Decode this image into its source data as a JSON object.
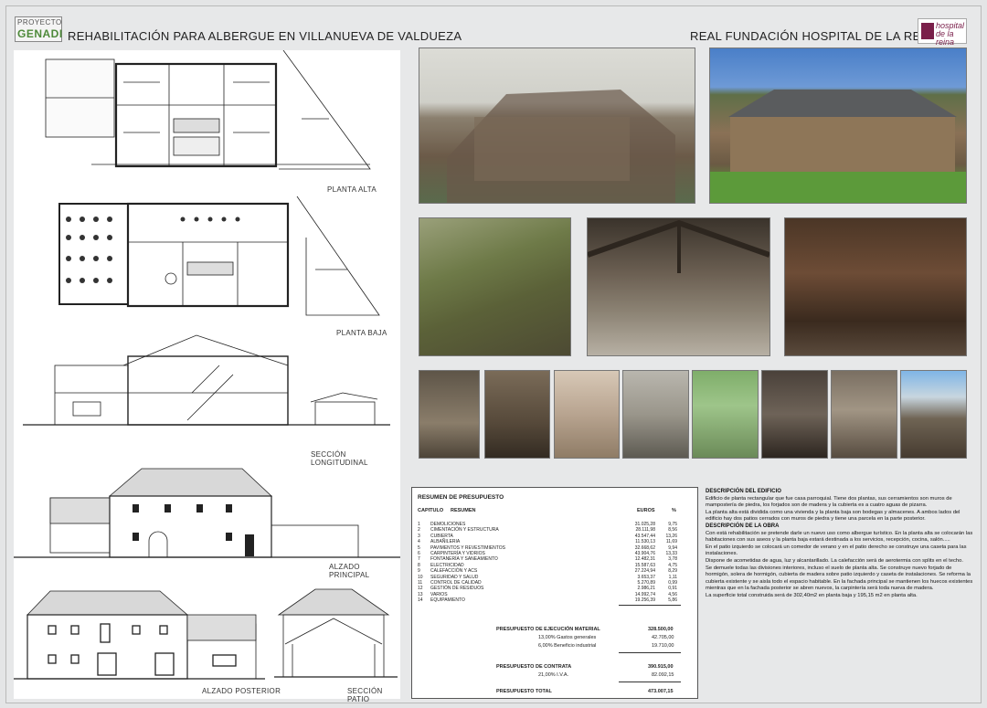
{
  "header": {
    "logo_top": "PROYECTO",
    "logo_bottom": "GENADI",
    "title": "REHABILITACIÓN PARA ALBERGUE EN VILLANUEVA DE VALDUEZA",
    "org": "REAL FUNDACIÓN HOSPITAL DE LA REINA",
    "org_logo_top": "hospital",
    "org_logo_bottom": "de la reina"
  },
  "drawings": {
    "planta_alta": "PLANTA ALTA",
    "planta_baja": "PLANTA BAJA",
    "seccion_longitudinal": "SECCIÓN LONGITUDINAL",
    "alzado_principal": "ALZADO PRINCIPAL",
    "alzado_posterior": "ALZADO POSTERIOR",
    "seccion_patio": "SECCIÓN PATIO"
  },
  "budget": {
    "title": "RESUMEN DE PRESUPUESTO",
    "headers": {
      "capitulo": "CAPITULO",
      "resumen": "RESUMEN",
      "euros": "EUROS",
      "pct": "%"
    },
    "rows": [
      {
        "n": "1",
        "name": "DEMOLICIONES",
        "euros": "31.025,28",
        "pct": "9,75"
      },
      {
        "n": "2",
        "name": "CIMENTACIÓN Y ESTRUCTURA",
        "euros": "28.111,98",
        "pct": "8,56"
      },
      {
        "n": "3",
        "name": "CUBIERTA",
        "euros": "43.547,44",
        "pct": "13,26"
      },
      {
        "n": "4",
        "name": "ALBAÑILERIA",
        "euros": "11.530,13",
        "pct": "11,69"
      },
      {
        "n": "5",
        "name": "PAVIMENTOS Y REVESTIMIENTOS",
        "euros": "32.668,62",
        "pct": "9,94"
      },
      {
        "n": "6",
        "name": "CARPINTERÍA Y VIDRIOS",
        "euros": "43.904,76",
        "pct": "13,33"
      },
      {
        "n": "7",
        "name": "FONTANERÍA Y SANEAMIENTO",
        "euros": "12.482,31",
        "pct": "3,78"
      },
      {
        "n": "8",
        "name": "ELECTRICIDAD",
        "euros": "15.587,63",
        "pct": "4,75"
      },
      {
        "n": "9",
        "name": "CALEFACCIÓN Y ACS",
        "euros": "27.224,94",
        "pct": "8,29"
      },
      {
        "n": "10",
        "name": "SEGURIDAD Y SALUD",
        "euros": "3.653,37",
        "pct": "1,11"
      },
      {
        "n": "11",
        "name": "CONTROL DE CALIDAD",
        "euros": "5.270,89",
        "pct": "0,99"
      },
      {
        "n": "12",
        "name": "GESTIÓN DE RESIDUOS",
        "euros": "2.986,21",
        "pct": "0,91"
      },
      {
        "n": "13",
        "name": "VARIOS",
        "euros": "14.992,74",
        "pct": "4,56"
      },
      {
        "n": "14",
        "name": "EQUIPAMIENTO",
        "euros": "19.256,39",
        "pct": "5,86"
      }
    ],
    "pem_label": "PRESUPUESTO DE EJECUCIÓN MATERIAL",
    "pem_value": "328.500,00",
    "gg_label": "13,00% Gastos generales",
    "gg_value": "42.705,00",
    "bi_label": "6,00% Beneficio industrial",
    "bi_value": "19.710,00",
    "pc_label": "PRESUPUESTO DE CONTRATA",
    "pc_value": "390.915,00",
    "iva_label": "21,00% I.V.A.",
    "iva_value": "82.092,15",
    "total_label": "PRESUPUESTO TOTAL",
    "total_value": "473.007,15"
  },
  "description": {
    "h1": "DESCRIPCIÓN DEL EDIFICIO",
    "p1": "Edificio de planta rectangular que fue casa parroquial. Tiene dos plantas, sus cerramientos son muros de mampostería de piedra, los forjados son de madera y la cubierta es a cuatro aguas de pizarra.",
    "p2": "La planta alta está dividida como una vivienda y la planta baja son bodegas y almacenes. A ambos lados del edificio hay dos patios cerrados con muros de piedra y tiene una parcela en la parte posterior.",
    "h2": "DESCRIPCIÓN DE LA OBRA",
    "p3": "Con está rehabilitación se pretende darle un nuevo uso como albergue turístico. En la planta alta se colocarán las habitaciones con sus aseos y la planta baja estará destinada a los servicios, recepción, cocina, salón.....",
    "p4": "En el patio izquierdo se colocará un comedor de verano y en el patio derecho se construye una caseta para las instalaciones.",
    "p5": "Dispone de acometidas de agua, luz y alcantarillado. La calefacción será de aerotermia con splits en el techo.",
    "p6": "Se demuele todas las divisiones interiores, incluso el suelo de planta alta. Se construye nuevo forjado de hormigón, solera de hormigón, cubierta de madera sobre patio izquierdo y caseta de instalaciones. Se reforma la cubierta existente y se aisla todo el espacio habitable. En la fachada principal se mantienen los huecos existentes mientras que en la fachada posterior se abren nuevos, la carpintería será toda nueva de madera.",
    "p7": "La superficie total construida será de 302,40m2 en planta baja y 195,15 m2 en planta alta."
  }
}
